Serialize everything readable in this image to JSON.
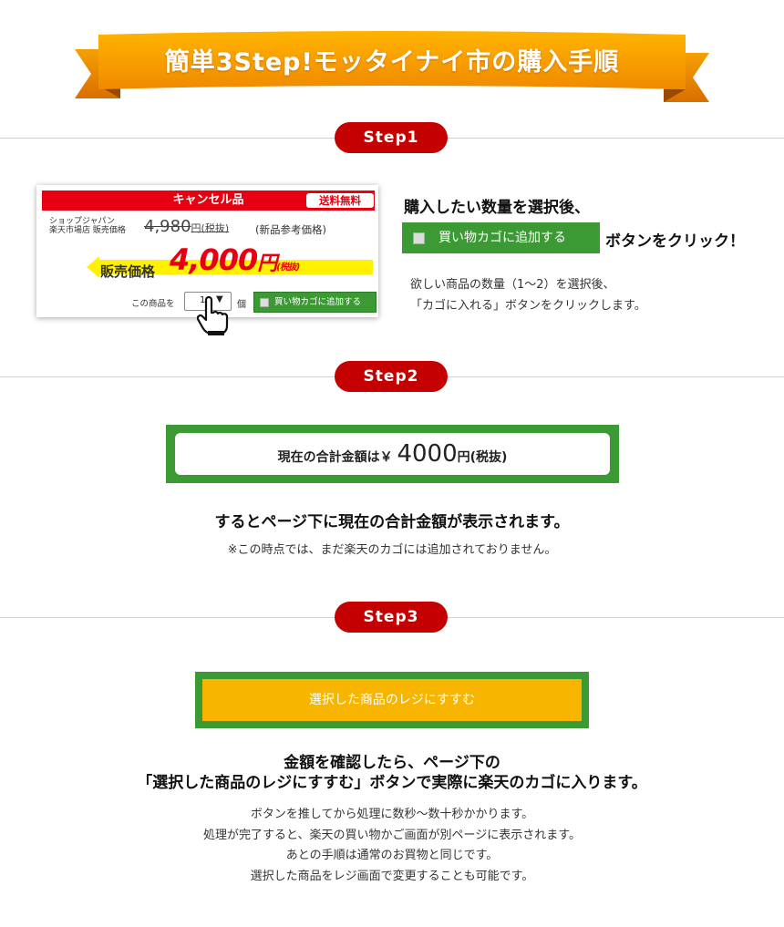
{
  "banner": {
    "title": "簡単3Step!モッタイナイ市の購入手順"
  },
  "steps": {
    "step1": "Step1",
    "step2": "Step2",
    "step3": "Step3"
  },
  "step1": {
    "card": {
      "header": "キャンセル品",
      "badge": "送料無料",
      "shop_line1": "ショップジャパン",
      "shop_line2": "楽天市場店 販売価格",
      "old_price": "4,980",
      "old_price_unit": "円(税抜)",
      "old_price_note": "(新品参考価格)",
      "sale_label": "販売価格",
      "sale_price": "4,000",
      "sale_price_unit": "円",
      "sale_price_tax": "(税抜)",
      "qty_label": "この商品を",
      "qty_value": "1",
      "qty_unit": "個",
      "cart_button": "買い物カゴに追加する"
    },
    "heading": "購入したい数量を選択後、",
    "cart_button": "買い物カゴに追加する",
    "heading_suffix": "ボタンをクリック！",
    "desc_line1": "欲しい商品の数量（1～2）を選択後、",
    "desc_line2": "「カゴに入れる」ボタンをクリックします。"
  },
  "step2": {
    "total_label": "現在の合計金額は￥",
    "total_amount": "4000",
    "total_unit": "円(税抜)",
    "heading": "するとページ下に現在の合計金額が表示されます。",
    "note": "※この時点では、まだ楽天のカゴには追加されておりません。"
  },
  "step3": {
    "checkout_button": "選択した商品のレジにすすむ",
    "heading_line1": "金額を確認したら、ページ下の",
    "heading_line2": "「選択した商品のレジにすすむ」ボタンで実際に楽天のカゴに入ります。",
    "desc_line1": "ボタンを推してから処理に数秒～数十秒かかります。",
    "desc_line2": "処理が完了すると、楽天の買い物かご画面が別ページに表示されます。",
    "desc_line3": "あとの手順は通常のお買物と同じです。",
    "desc_line4": "選択した商品をレジ画面で変更することも可能です。"
  },
  "colors": {
    "banner_orange": "#f39800",
    "step_red": "#c40000",
    "cart_green": "#3c9a34",
    "checkout_yellow": "#f7b500",
    "price_red": "#e60012",
    "arrow_yellow": "#fff100"
  }
}
